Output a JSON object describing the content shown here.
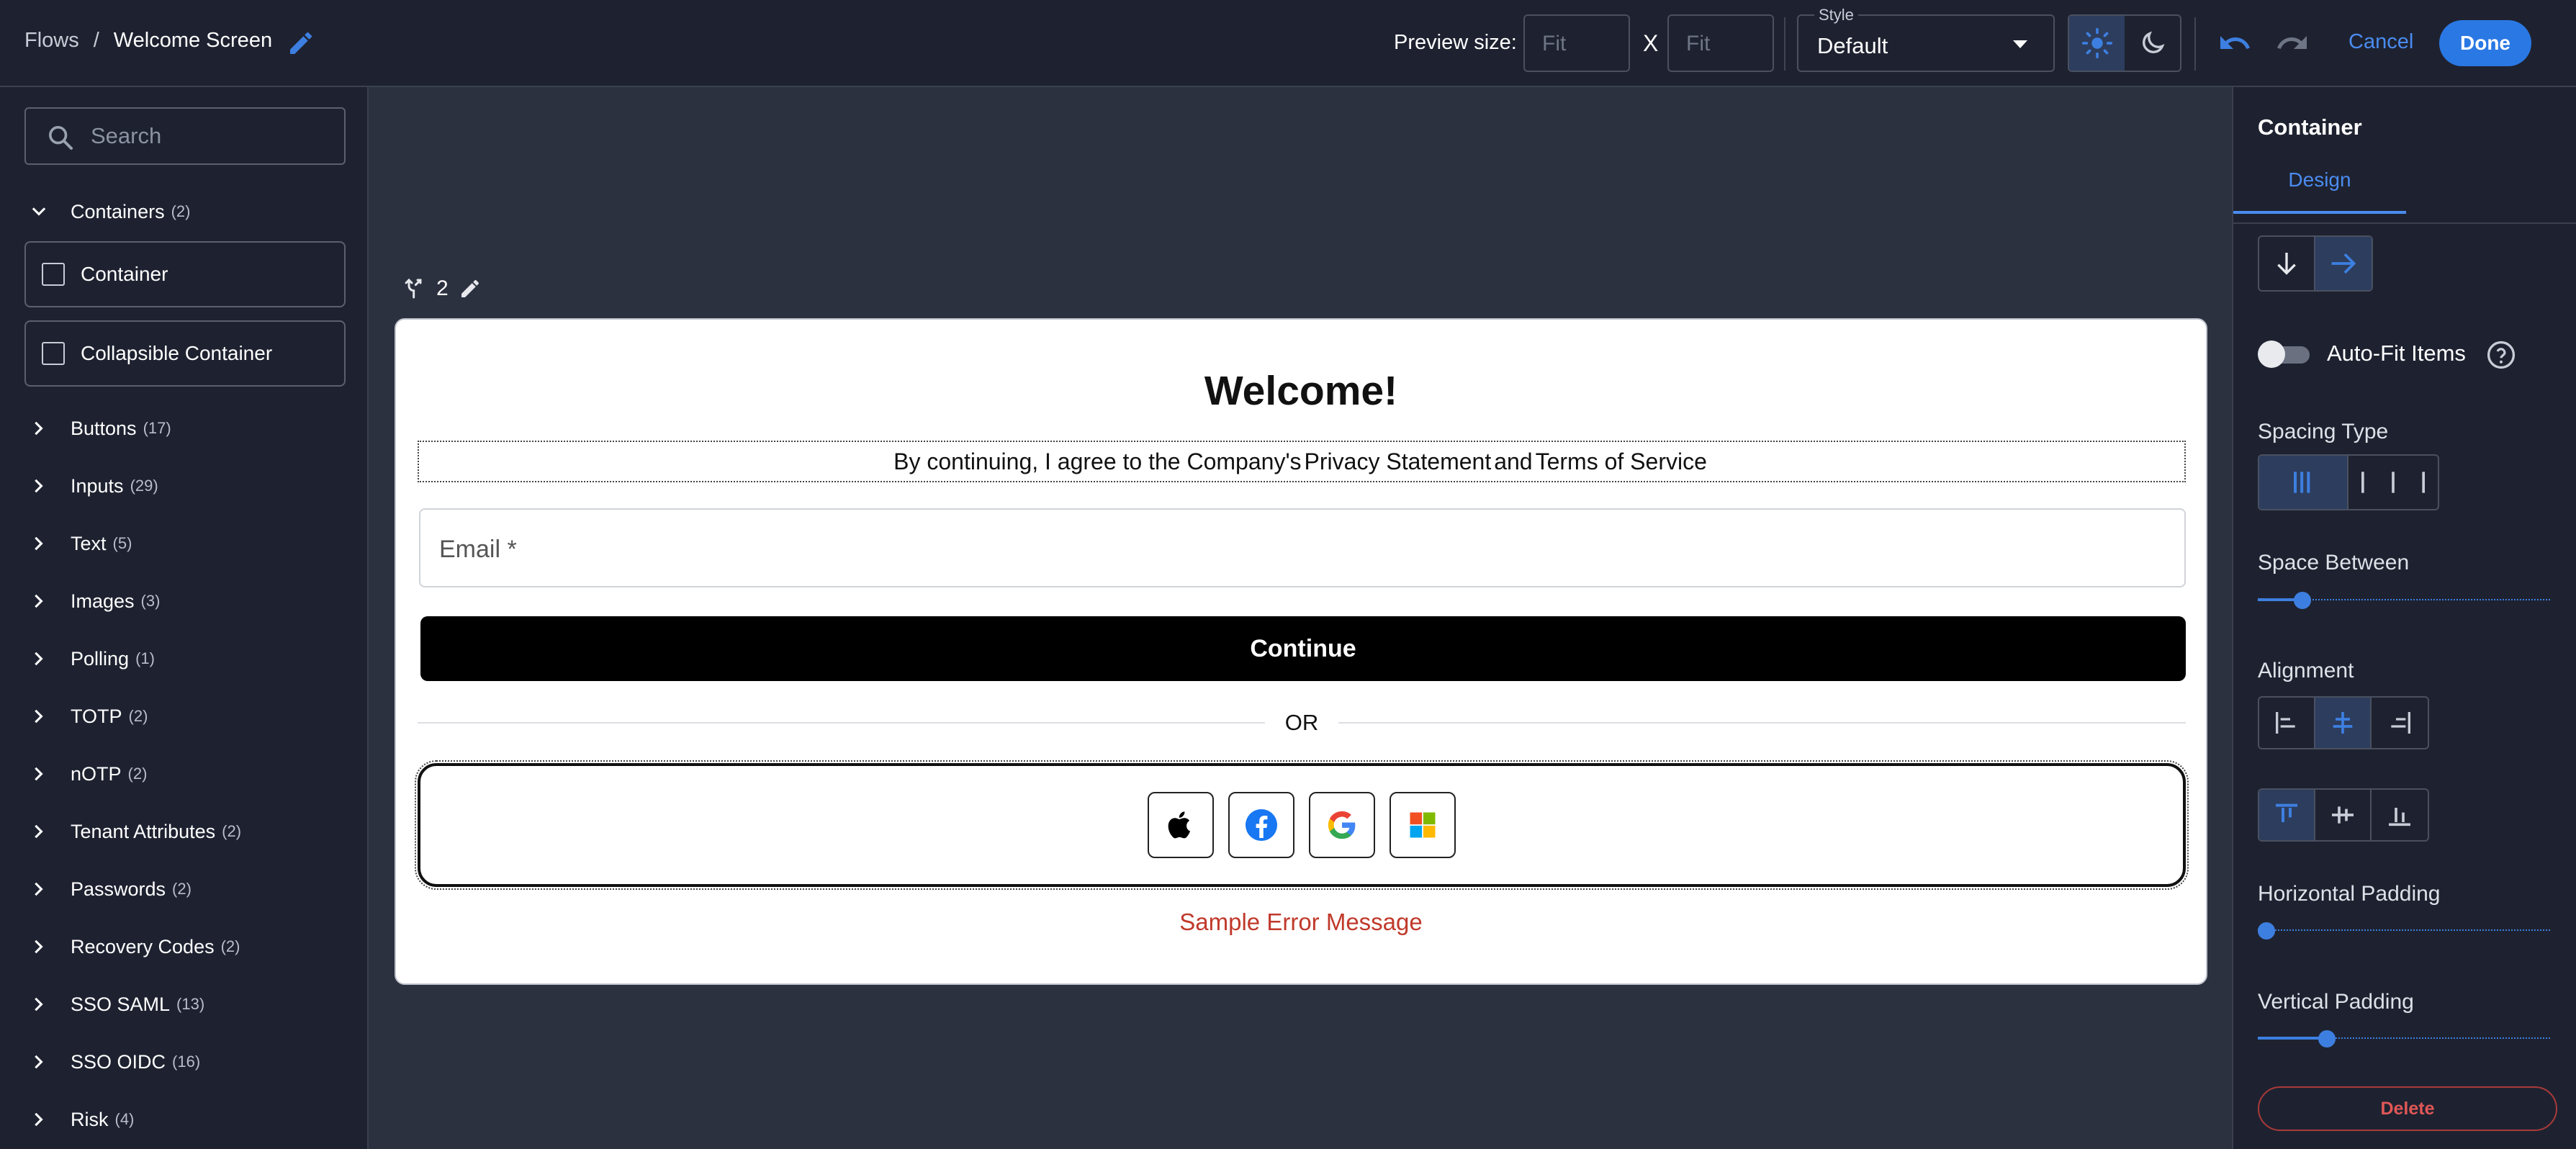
{
  "header": {
    "breadcrumb_root": "Flows",
    "breadcrumb_sep": "/",
    "breadcrumb_current": "Welcome Screen",
    "preview_label": "Preview size:",
    "width_placeholder": "Fit",
    "height_placeholder": "Fit",
    "size_separator": "X",
    "style_legend": "Style",
    "style_value": "Default",
    "cancel_label": "Cancel",
    "done_label": "Done"
  },
  "sidebar": {
    "search_placeholder": "Search",
    "categories": [
      {
        "label": "Containers",
        "count": "(2)",
        "expanded": true
      },
      {
        "label": "Buttons",
        "count": "(17)"
      },
      {
        "label": "Inputs",
        "count": "(29)"
      },
      {
        "label": "Text",
        "count": "(5)"
      },
      {
        "label": "Images",
        "count": "(3)"
      },
      {
        "label": "Polling",
        "count": "(1)"
      },
      {
        "label": "TOTP",
        "count": "(2)"
      },
      {
        "label": "nOTP",
        "count": "(2)"
      },
      {
        "label": "Tenant Attributes",
        "count": "(2)"
      },
      {
        "label": "Passwords",
        "count": "(2)"
      },
      {
        "label": "Recovery Codes",
        "count": "(2)"
      },
      {
        "label": "SSO SAML",
        "count": "(13)"
      },
      {
        "label": "SSO OIDC",
        "count": "(16)"
      },
      {
        "label": "Risk",
        "count": "(4)"
      }
    ],
    "components": [
      "Container",
      "Collapsible Container"
    ]
  },
  "canvas": {
    "branch_count": "2",
    "title": "Welcome!",
    "terms_prefix": "By continuing, I agree to the Company's",
    "privacy_link": "Privacy Statement",
    "terms_and": "and",
    "terms_link": "Terms of Service",
    "email_placeholder": "Email *",
    "continue_label": "Continue",
    "or_label": "OR",
    "social_providers": [
      "apple",
      "facebook",
      "google",
      "microsoft"
    ],
    "error_message": "Sample Error Message"
  },
  "panel": {
    "title": "Container",
    "tab_design": "Design",
    "auto_fit_label": "Auto-Fit Items",
    "auto_fit_on": false,
    "spacing_type_label": "Spacing Type",
    "space_between_label": "Space Between",
    "space_between_value": 0.13,
    "alignment_label": "Alignment",
    "horizontal_padding_label": "Horizontal Padding",
    "horizontal_padding_value": 0.0,
    "vertical_padding_label": "Vertical Padding",
    "vertical_padding_value": 0.22,
    "delete_label": "Delete"
  },
  "colors": {
    "accent": "#2a78e4",
    "error": "#c0392b",
    "delete": "#e05757"
  }
}
